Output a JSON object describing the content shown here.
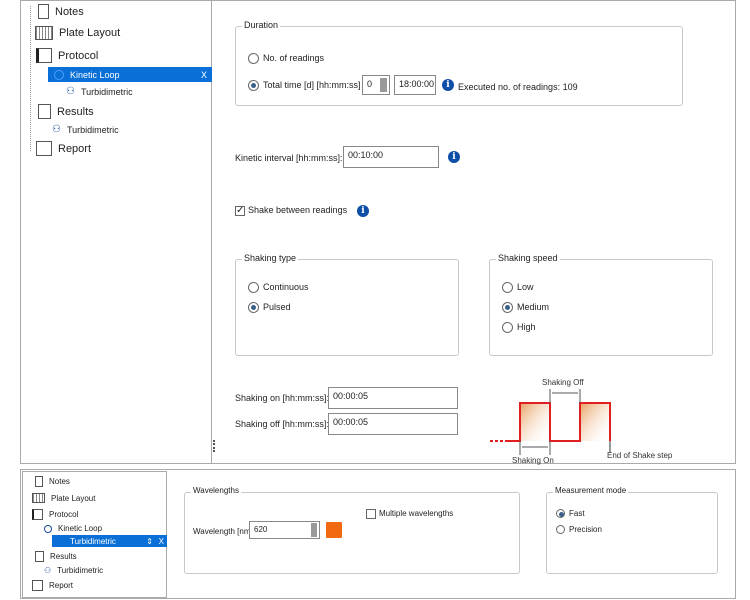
{
  "top_tree": {
    "items": [
      {
        "label": "Notes",
        "icon": "notes-icon"
      },
      {
        "label": "Plate Layout",
        "icon": "plate-layout-icon"
      },
      {
        "label": "Protocol",
        "icon": "protocol-icon"
      },
      {
        "label": "Kinetic Loop",
        "icon": "loop-icon",
        "close": "X"
      },
      {
        "label": "Turbidimetric",
        "icon": "turbidimetric-icon"
      },
      {
        "label": "Results",
        "icon": "results-icon"
      },
      {
        "label": "Turbidimetric",
        "icon": "turbidimetric-icon"
      },
      {
        "label": "Report",
        "icon": "report-icon"
      }
    ]
  },
  "duration": {
    "title": "Duration",
    "no_readings": "No. of readings",
    "total_time": "Total time [d] [hh:mm:ss]",
    "days": "0",
    "time": "18:00:00",
    "executed": "Executed no. of readings: 109",
    "selected": "total_time"
  },
  "kinetic_interval": {
    "label": "Kinetic interval [hh:mm:ss]:",
    "value": "00:10:00"
  },
  "shake_between": {
    "label": "Shake between readings",
    "checked": true
  },
  "shaking_type": {
    "title": "Shaking type",
    "options": [
      "Continuous",
      "Pulsed"
    ],
    "selected": "Pulsed"
  },
  "shaking_speed": {
    "title": "Shaking speed",
    "options": [
      "Low",
      "Medium",
      "High"
    ],
    "selected": "Medium"
  },
  "shaking_on": {
    "label": "Shaking on [hh:mm:ss]:",
    "value": "00:00:05"
  },
  "shaking_off": {
    "label": "Shaking off [hh:mm:ss]:",
    "value": "00:00:05"
  },
  "diagram": {
    "off_label": "Shaking Off",
    "on_label": "Shaking On",
    "end_label": "End of Shake step",
    "color": "#e02020"
  },
  "bottom_tree": {
    "items": [
      {
        "label": "Notes"
      },
      {
        "label": "Plate Layout"
      },
      {
        "label": "Protocol"
      },
      {
        "label": "Kinetic Loop"
      },
      {
        "label": "Turbidimetric",
        "close": "X"
      },
      {
        "label": "Results"
      },
      {
        "label": "Turbidimetric"
      },
      {
        "label": "Report"
      }
    ]
  },
  "wavelengths": {
    "title": "Wavelengths",
    "multiple": "Multiple wavelengths",
    "label": "Wavelength [nm]:",
    "value": "620",
    "swatch": "#f26a10"
  },
  "measurement_mode": {
    "title": "Measurement mode",
    "options": [
      "Fast",
      "Precision"
    ],
    "selected": "Fast"
  },
  "accent": "#0a6fd6"
}
